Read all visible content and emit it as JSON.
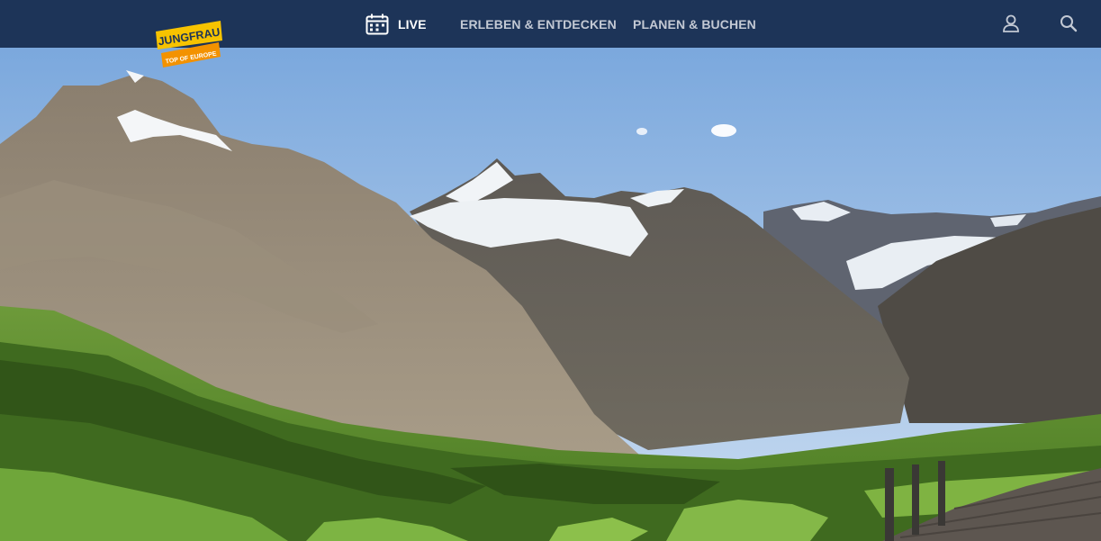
{
  "brand": {
    "logo_top": "JUNGFRAU",
    "logo_bottom": "TOP OF EUROPE"
  },
  "nav": {
    "items": [
      {
        "label": "LIVE",
        "icon": "calendar-icon",
        "active": true
      },
      {
        "label": "ERLEBEN & ENTDECKEN",
        "active": false
      },
      {
        "label": "PLANEN & BUCHEN",
        "active": false
      }
    ],
    "right_icons": [
      "user-icon",
      "search-icon"
    ]
  },
  "colors": {
    "nav_bg": "#1d3458",
    "logo_yellow": "#f7c300",
    "logo_orange": "#f39200"
  }
}
